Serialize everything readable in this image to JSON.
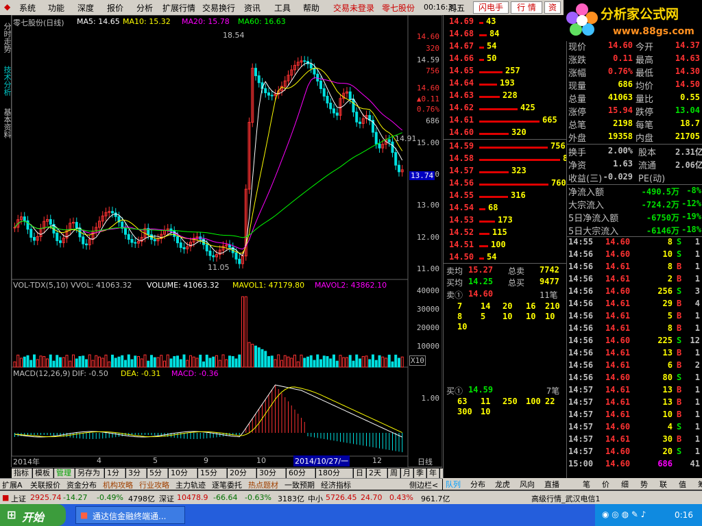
{
  "menubar": {
    "items": [
      "系统",
      "功能",
      "深度",
      "报价",
      "分析",
      "扩展行情",
      "交易换行",
      "资讯",
      "工具",
      "帮助"
    ],
    "trade_status": "交易未登录",
    "stock": "零七股份",
    "time": "00:16:31",
    "weekday": "周五",
    "buttons": [
      "闪电手",
      "行 情",
      "资"
    ]
  },
  "logo": {
    "title": "分析家公式网",
    "url": "www.88gs.com"
  },
  "sidetabs": [
    "分时走势",
    "技术分析",
    "基本资料"
  ],
  "price_panel": {
    "title": "零七股份(日线)",
    "ma5": "MA5: 14.65",
    "ma10": "MA10: 15.32",
    "ma20": "MA20: 15.78",
    "ma60": "MA60: 16.63",
    "high_label": "18.54",
    "low_label": "11.05",
    "last_label": "14.91",
    "price_ticks": [
      "15.00",
      "14.00",
      "13.00",
      "12.00",
      "11.00"
    ],
    "current": "13.74",
    "quote_box": [
      "14.60",
      "320",
      "14.59",
      "756",
      "14.60",
      "▲0.11",
      "0.76%",
      "686"
    ]
  },
  "vol_panel": {
    "title": "VOL-TDX(5,10)",
    "vvol": "VVOL: 41063.32",
    "volume": "VOLUME: 41063.32",
    "mavol1": "MAVOL1: 47179.80",
    "mavol2": "MAVOL2: 43862.10",
    "ticks": [
      "40000",
      "30000",
      "20000",
      "10000"
    ],
    "unit": "X10"
  },
  "macd_panel": {
    "title": "MACD(12,26,9)",
    "dif": "DIF: -0.50",
    "dea": "DEA: -0.31",
    "macd": "MACD: -0.36",
    "tick": "1.00"
  },
  "time_axis": {
    "labels": [
      "2014年",
      "4",
      "5",
      "9",
      "10",
      "12"
    ],
    "cursor": "2014/10/27/一",
    "period": "日线"
  },
  "bottom_buttons": [
    "指标",
    "模板",
    "管理",
    "另存为",
    "1分",
    "3分",
    "5分",
    "10分",
    "15分",
    "20分",
    "30分",
    "60分",
    "180分",
    "日",
    "2天",
    "周",
    "月",
    "季",
    "年",
    "+",
    "-"
  ],
  "tabs2": [
    "扩展A",
    "关联报价",
    "资金分布",
    "机构攻略",
    "行业攻略",
    "主力轨迹",
    "逐笔委托",
    "热点题材",
    "一致预期",
    "经济指标"
  ],
  "tabs2_extra": "侧边栏<",
  "order_book": {
    "asks": [
      [
        "14.69",
        "43"
      ],
      [
        "14.68",
        "84"
      ],
      [
        "14.67",
        "54"
      ],
      [
        "14.66",
        "50"
      ],
      [
        "14.65",
        "257"
      ],
      [
        "14.64",
        "193"
      ],
      [
        "14.63",
        "228"
      ],
      [
        "14.62",
        "425"
      ],
      [
        "14.61",
        "665"
      ],
      [
        "14.60",
        "320"
      ]
    ],
    "bids": [
      [
        "14.59",
        "756"
      ],
      [
        "14.58",
        "888"
      ],
      [
        "14.57",
        "323"
      ],
      [
        "14.56",
        "760"
      ],
      [
        "14.55",
        "316"
      ],
      [
        "14.54",
        "68"
      ],
      [
        "14.53",
        "173"
      ],
      [
        "14.52",
        "115"
      ],
      [
        "14.51",
        "100"
      ],
      [
        "14.50",
        "54"
      ]
    ],
    "sell_avg_label": "卖均",
    "sell_avg": "15.27",
    "total_sell_label": "总卖",
    "total_sell": "7742",
    "buy_avg_label": "买均",
    "buy_avg": "14.25",
    "total_buy_label": "总买",
    "total_buy": "9477",
    "sell1_label": "卖①",
    "sell1_price": "14.60",
    "sell1_count": "11笔",
    "sell1_queue": [
      "7",
      "14",
      "20",
      "16",
      "210",
      "8",
      "5",
      "10",
      "10",
      "10",
      "10"
    ],
    "buy1_label": "买①",
    "buy1_price": "14.59",
    "buy1_count": "7笔",
    "buy1_queue": [
      "63",
      "11",
      "250",
      "100",
      "22",
      "300",
      "10"
    ]
  },
  "quote": {
    "rows": [
      [
        "现价",
        "14.60",
        "今开",
        "14.37"
      ],
      [
        "涨跌",
        "0.11",
        "最高",
        "14.63"
      ],
      [
        "涨幅",
        "0.76%",
        "最低",
        "14.30"
      ],
      [
        "现量",
        "686",
        "均价",
        "14.50"
      ],
      [
        "总量",
        "41063",
        "量比",
        "0.55"
      ],
      [
        "涨停",
        "15.94",
        "跌停",
        "13.04"
      ],
      [
        "总笔",
        "2198",
        "每笔",
        "18.7"
      ],
      [
        "外盘",
        "19358",
        "内盘",
        "21705"
      ]
    ],
    "rows2": [
      [
        "换手",
        "2.00%",
        "股本",
        "2.31亿"
      ],
      [
        "净资",
        "1.63",
        "流通",
        "2.06亿"
      ],
      [
        "收益(三)",
        "-0.029",
        "PE(动)",
        ""
      ]
    ],
    "flows": [
      [
        "净流入额",
        "-490.5万",
        "-8%"
      ],
      [
        "大宗流入",
        "-724.2万",
        "-12%"
      ],
      [
        "5日净流入额",
        "-6750万",
        "-19%"
      ],
      [
        "5日大宗流入",
        "-6146万",
        "-18%"
      ]
    ]
  },
  "ticks": [
    [
      "14:55",
      "14.60",
      "8",
      "S",
      "1"
    ],
    [
      "14:56",
      "14.60",
      "10",
      "S",
      "1"
    ],
    [
      "14:56",
      "14.61",
      "8",
      "B",
      "1"
    ],
    [
      "14:56",
      "14.61",
      "2",
      "B",
      "1"
    ],
    [
      "14:56",
      "14.60",
      "256",
      "S",
      "3"
    ],
    [
      "14:56",
      "14.61",
      "29",
      "B",
      "4"
    ],
    [
      "14:56",
      "14.61",
      "5",
      "B",
      "1"
    ],
    [
      "14:56",
      "14.61",
      "8",
      "B",
      "1"
    ],
    [
      "14:56",
      "14.60",
      "225",
      "S",
      "12"
    ],
    [
      "14:56",
      "14.61",
      "13",
      "B",
      "1"
    ],
    [
      "14:56",
      "14.61",
      "6",
      "B",
      "2"
    ],
    [
      "14:56",
      "14.60",
      "80",
      "S",
      "1"
    ],
    [
      "14:57",
      "14.61",
      "13",
      "B",
      "1"
    ],
    [
      "14:57",
      "14.61",
      "13",
      "B",
      "1"
    ],
    [
      "14:57",
      "14.61",
      "10",
      "B",
      "1"
    ],
    [
      "14:57",
      "14.60",
      "4",
      "S",
      "1"
    ],
    [
      "14:57",
      "14.61",
      "30",
      "B",
      "1"
    ],
    [
      "14:57",
      "14.60",
      "20",
      "S",
      "1"
    ],
    [
      "15:00",
      "14.60",
      "686",
      "",
      "41"
    ]
  ],
  "rtabs": [
    "队列",
    "分布",
    "龙虎",
    "风向",
    "直播",
    "笔",
    "价",
    "细",
    "势",
    "联",
    "值",
    "筹"
  ],
  "status": {
    "sh_label": "上证",
    "sh_value": "2925.74",
    "sh_change": "-14.27",
    "sh_pct": "-0.49%",
    "sh_amt": "4798亿",
    "sz_label": "深证",
    "sz_value": "10478.9",
    "sz_change": "-66.64",
    "sz_pct": "-0.63%",
    "sz_amt": "3183亿",
    "zx_label": "中小",
    "zx_value": "5726.45",
    "zx_change": "24.70",
    "zx_pct": "0.43%",
    "zx_amt": "961.7亿",
    "server": "高级行情_武汉电信1"
  },
  "taskbar": {
    "start": "开始",
    "task": "通达信金融终端通...",
    "clock": "0:16"
  },
  "colors": {
    "up": "#ff3232",
    "down": "#00e0e0",
    "green": "#00ff00",
    "yellow": "#ffff00",
    "ma5": "#ffffff",
    "ma10": "#ffff00",
    "ma20": "#ff00ff",
    "ma60": "#00ff00"
  }
}
